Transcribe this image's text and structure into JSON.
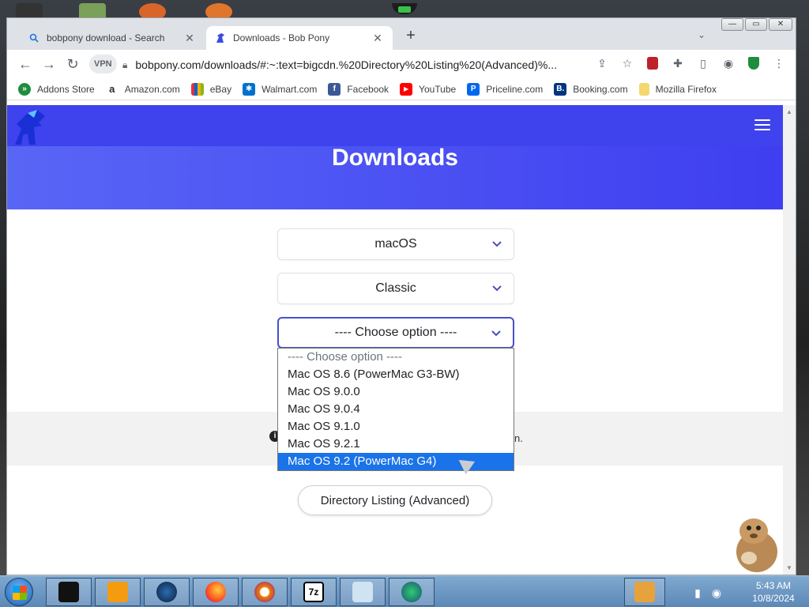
{
  "tabs": [
    {
      "label": "bobpony download - Search",
      "icon": "search-icon",
      "active": false
    },
    {
      "label": "Downloads - Bob Pony",
      "icon": "bobpony-favicon-icon",
      "active": true
    }
  ],
  "toolbar": {
    "vpn_label": "VPN",
    "url": "bobpony.com/downloads/#:~:text=bigcdn.%20Directory%20Listing%20(Advanced)%..."
  },
  "bookmarks": [
    {
      "label": "Addons Store",
      "icon": "addons-store-icon",
      "color": "#1e8e3e"
    },
    {
      "label": "Amazon.com",
      "icon": "amazon-icon",
      "color": "#232f3e"
    },
    {
      "label": "eBay",
      "icon": "ebay-icon",
      "color": "#e53238"
    },
    {
      "label": "Walmart.com",
      "icon": "walmart-icon",
      "color": "#0071ce"
    },
    {
      "label": "Facebook",
      "icon": "facebook-icon",
      "color": "#3b5998"
    },
    {
      "label": "YouTube",
      "icon": "youtube-icon",
      "color": "#ff0000"
    },
    {
      "label": "Priceline.com",
      "icon": "priceline-icon",
      "color": "#0068ef"
    },
    {
      "label": "Booking.com",
      "icon": "booking-icon",
      "color": "#003580"
    },
    {
      "label": "Mozilla Firefox",
      "icon": "folder-icon",
      "color": "#f5d76e"
    }
  ],
  "page": {
    "title": "Downloads",
    "select_os": "macOS",
    "select_family": "Classic",
    "select_version": "---- Choose option ----",
    "info_tail": "n.",
    "dir_button": "Directory Listing (Advanced)"
  },
  "dropdown": {
    "options": [
      "---- Choose option ----",
      "Mac OS 8.6 (PowerMac G3-BW)",
      "Mac OS 9.0.0",
      "Mac OS 9.0.4",
      "Mac OS 9.1.0",
      "Mac OS 9.2.1",
      "Mac OS 9.2 (PowerMac G4)"
    ],
    "highlighted_index": 6
  },
  "taskbar": {
    "time": "5:43 AM",
    "date": "10/8/2024",
    "apps": [
      "terminal-icon",
      "media-player-icon",
      "globe-icon",
      "firefox-icon",
      "avast-browser-icon",
      "7zip-icon",
      "notepad-icon",
      "download-manager-icon"
    ]
  },
  "colors": {
    "hero_start": "#5866f6",
    "hero_end": "#3f3ef0",
    "accent": "#4a50c8",
    "selection": "#1a73e8"
  }
}
